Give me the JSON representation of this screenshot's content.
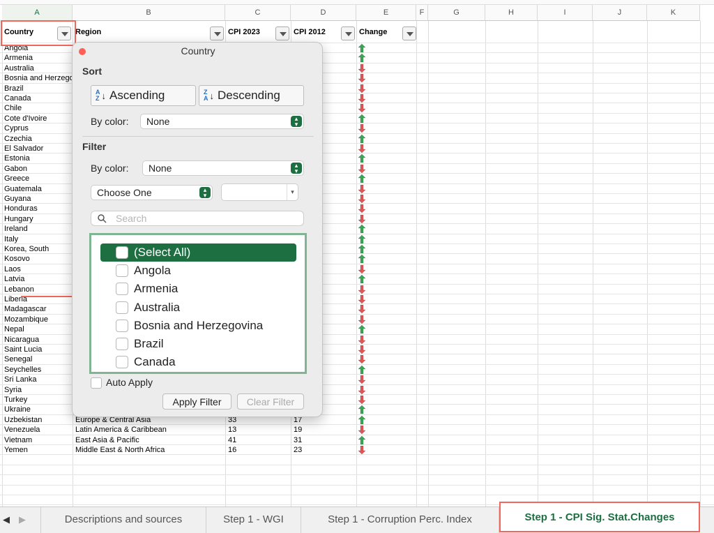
{
  "columns": [
    "A",
    "B",
    "C",
    "D",
    "E",
    "F",
    "G",
    "H",
    "I",
    "J",
    "K"
  ],
  "headers": {
    "country": "Country",
    "region": "Region",
    "cpi2023": "CPI 2023",
    "cpi2012": "CPI 2012",
    "change": "Change"
  },
  "countries": [
    "Angola",
    "Armenia",
    "Australia",
    "Bosnia and Herzegovina",
    "Brazil",
    "Canada",
    "Chile",
    "Cote d'Ivoire",
    "Cyprus",
    "Czechia",
    "El Salvador",
    "Estonia",
    "Gabon",
    "Greece",
    "Guatemala",
    "Guyana",
    "Honduras",
    "Hungary",
    "Ireland",
    "Italy",
    "Korea, South",
    "Kosovo",
    "Laos",
    "Latvia",
    "Lebanon",
    "Liberia",
    "Madagascar",
    "Mozambique",
    "Nepal",
    "Nicaragua",
    "Saint Lucia",
    "Senegal",
    "Seychelles",
    "Sri Lanka",
    "Syria",
    "Turkey",
    "Ukraine",
    "Uzbekistan",
    "Venezuela",
    "Vietnam",
    "Yemen"
  ],
  "change_directions": [
    "up",
    "up",
    "down",
    "down",
    "down",
    "down",
    "down",
    "up",
    "down",
    "up",
    "down",
    "up",
    "down",
    "up",
    "down",
    "down",
    "down",
    "down",
    "up",
    "up",
    "up",
    "up",
    "down",
    "up",
    "down",
    "down",
    "down",
    "down",
    "up",
    "down",
    "down",
    "down",
    "up",
    "down",
    "down",
    "down",
    "up",
    "up",
    "down",
    "up",
    "down"
  ],
  "visible_rows": [
    {
      "region": "Europe & Central Asia",
      "cpi2023": "33",
      "cpi2012": "17"
    },
    {
      "region": "Latin America & Caribbean",
      "cpi2023": "13",
      "cpi2012": "19"
    },
    {
      "region": "East Asia & Pacific",
      "cpi2023": "41",
      "cpi2012": "31"
    },
    {
      "region": "Middle East & North Africa",
      "cpi2023": "16",
      "cpi2012": "23"
    }
  ],
  "filter_popover": {
    "title": "Country",
    "sort_label": "Sort",
    "ascending": "Ascending",
    "descending": "Descending",
    "by_color_label": "By color:",
    "sort_color_value": "None",
    "filter_label": "Filter",
    "filter_color_value": "None",
    "choose_one": "Choose One",
    "search_placeholder": "Search",
    "list_items": [
      "(Select All)",
      "Angola",
      "Armenia",
      "Australia",
      "Bosnia and Herzegovina",
      "Brazil",
      "Canada"
    ],
    "auto_apply": "Auto Apply",
    "apply_filter": "Apply Filter",
    "clear_filter": "Clear Filter"
  },
  "tabs": [
    "Descriptions and sources",
    "Step 1 - WGI",
    "Step 1 - Corruption Perc. Index",
    "Step 1 - CPI Sig. Stat.Changes"
  ],
  "colors": {
    "accent_green": "#1d6f42",
    "up_arrow": "#3aa655",
    "down_arrow": "#e05555",
    "highlight": "#f0675b"
  }
}
